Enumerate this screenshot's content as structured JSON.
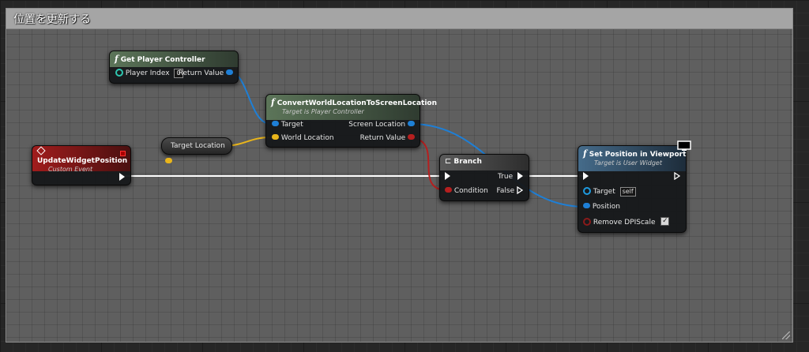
{
  "comment": {
    "title": "位置を更新する"
  },
  "nodes": {
    "get_player_controller": {
      "title": "Get Player Controller",
      "pins": {
        "player_index": "Player Index",
        "player_index_value": "0",
        "return_value": "Return Value"
      }
    },
    "convert_world_location": {
      "title": "ConvertWorldLocationToScreenLocation",
      "subtitle": "Target is Player Controller",
      "pins": {
        "target": "Target",
        "world_location": "World Location",
        "screen_location": "Screen Location",
        "return_value": "Return Value"
      }
    },
    "target_location_var": {
      "label": "Target Location"
    },
    "update_widget_position": {
      "title": "UpdateWidgetPosition",
      "subtitle": "Custom Event"
    },
    "branch": {
      "title": "Branch",
      "pins": {
        "condition": "Condition",
        "true": "True",
        "false": "False"
      }
    },
    "set_position_in_viewport": {
      "title": "Set Position in Viewport",
      "subtitle": "Target is User Widget",
      "pins": {
        "target": "Target",
        "target_value": "self",
        "position": "Position",
        "remove_dpi_scale": "Remove DPIScale"
      },
      "remove_dpi_scale_checked": true
    }
  },
  "colors": {
    "exec_wire": "#ffffff",
    "vector2d_wire": "#1e7fd6",
    "vector_wire": "#e9b51b",
    "bool_wire": "#b51f1f",
    "function_header": "#5a6e57",
    "event_header": "#8b1a1a",
    "branch_header": "#4d4d4d",
    "set_header": "#3f5f7a"
  },
  "icons": {
    "function": "function-f-icon",
    "event": "event-diamond-icon",
    "branch": "branch-icon",
    "monitor": "monitor-icon"
  }
}
